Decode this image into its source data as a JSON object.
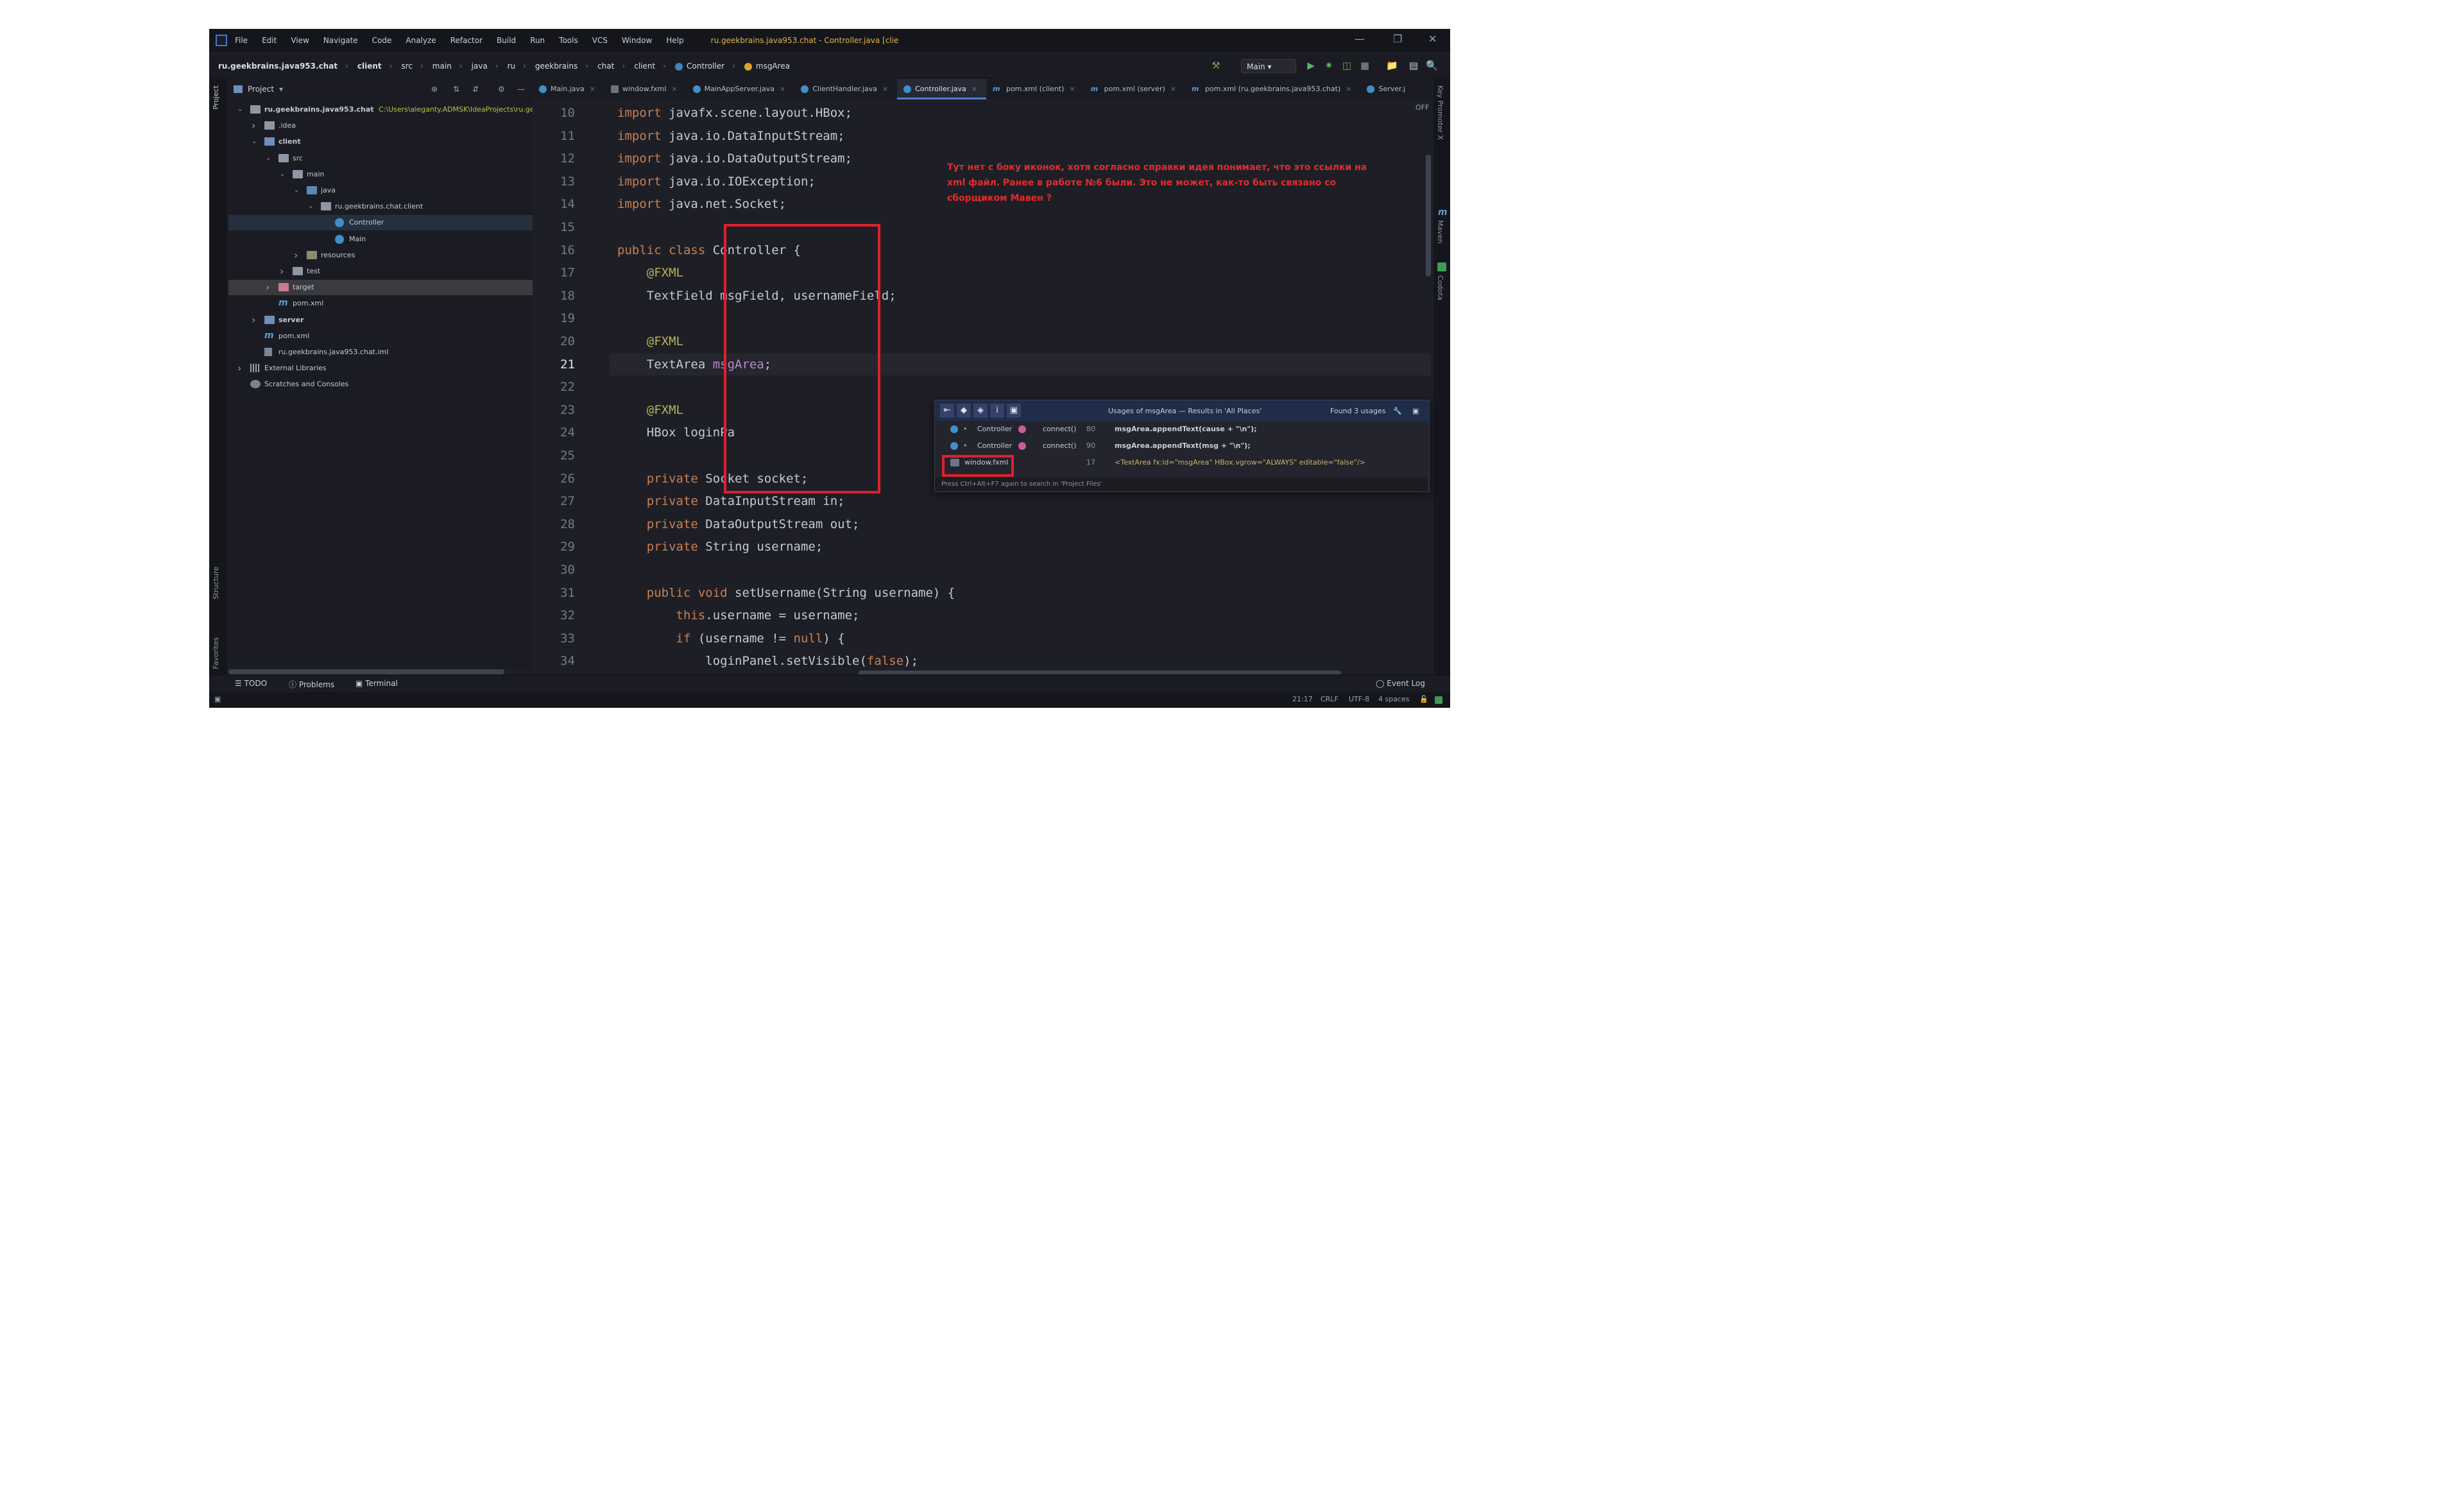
{
  "window": {
    "title": "ru.geekbrains.java953.chat - Controller.java [clie",
    "menu": [
      "File",
      "Edit",
      "View",
      "Navigate",
      "Code",
      "Analyze",
      "Refactor",
      "Build",
      "Run",
      "Tools",
      "VCS",
      "Window",
      "Help"
    ]
  },
  "breadcrumbs": [
    "ru.geekbrains.java953.chat",
    "client",
    "src",
    "main",
    "java",
    "ru",
    "geekbrains",
    "chat",
    "client",
    "Controller",
    "msgArea"
  ],
  "toolbar": {
    "run_config": "Main"
  },
  "left_strip": {
    "project": "Project",
    "structure": "Structure",
    "favorites": "Favorites"
  },
  "right_strip": {
    "key_promoter": "Key Promoter X",
    "maven": "Maven",
    "codota": "Codota"
  },
  "project_panel": {
    "title": "Project",
    "tree": [
      {
        "label": "ru.geekbrains.java953.chat",
        "extra": "C:\\Users\\aleganty.ADMSK\\IdeaProjects\\ru.gee",
        "depth": 0,
        "icon": "folder",
        "arrow": "down",
        "bold": true
      },
      {
        "label": ".idea",
        "depth": 1,
        "icon": "folder",
        "arrow": "right"
      },
      {
        "label": "client",
        "depth": 1,
        "icon": "folder-blue",
        "arrow": "down",
        "bold": true
      },
      {
        "label": "src",
        "depth": 2,
        "icon": "folder",
        "arrow": "down"
      },
      {
        "label": "main",
        "depth": 3,
        "icon": "folder",
        "arrow": "down"
      },
      {
        "label": "java",
        "depth": 4,
        "icon": "folder-src",
        "arrow": "down"
      },
      {
        "label": "ru.geekbrains.chat.client",
        "depth": 5,
        "icon": "folder",
        "arrow": "down"
      },
      {
        "label": "Controller",
        "depth": 6,
        "icon": "class",
        "selected": true
      },
      {
        "label": "Main",
        "depth": 6,
        "icon": "class"
      },
      {
        "label": "resources",
        "depth": 4,
        "icon": "folder-res",
        "arrow": "right"
      },
      {
        "label": "test",
        "depth": 3,
        "icon": "folder",
        "arrow": "right"
      },
      {
        "label": "target",
        "depth": 2,
        "icon": "folder-target",
        "arrow": "right",
        "highlight": true
      },
      {
        "label": "pom.xml",
        "depth": 2,
        "icon": "xml"
      },
      {
        "label": "server",
        "depth": 1,
        "icon": "folder-blue",
        "arrow": "right",
        "bold": true
      },
      {
        "label": "pom.xml",
        "depth": 1,
        "icon": "xml"
      },
      {
        "label": "ru.geekbrains.java953.chat.iml",
        "depth": 1,
        "icon": "iml"
      },
      {
        "label": "External Libraries",
        "depth": 0,
        "icon": "lib",
        "arrow": "right"
      },
      {
        "label": "Scratches and Consoles",
        "depth": 0,
        "icon": "scratch"
      }
    ]
  },
  "tabs": [
    {
      "label": "Main.java",
      "icon": "class"
    },
    {
      "label": "window.fxml",
      "icon": "fxml"
    },
    {
      "label": "MainAppServer.java",
      "icon": "class"
    },
    {
      "label": "ClientHandler.java",
      "icon": "class"
    },
    {
      "label": "Controller.java",
      "icon": "class",
      "active": true
    },
    {
      "label": "pom.xml (client)",
      "icon": "xml"
    },
    {
      "label": "pom.xml (server)",
      "icon": "xml"
    },
    {
      "label": "pom.xml (ru.geekbrains.java953.chat)",
      "icon": "xml"
    },
    {
      "label": "Server.j",
      "icon": "class"
    }
  ],
  "editor": {
    "current_line": 21,
    "lines": [
      {
        "n": 10,
        "html": "<span class=\"kw\">import</span> javafx.scene.layout.HBox;"
      },
      {
        "n": 11,
        "html": "<span class=\"kw\">import</span> java.io.DataInputStream;"
      },
      {
        "n": 12,
        "html": "<span class=\"kw\">import</span> java.io.DataOutputStream;"
      },
      {
        "n": 13,
        "html": "<span class=\"kw\">import</span> java.io.IOException;"
      },
      {
        "n": 14,
        "html": "<span class=\"kw\">import</span> java.net.Socket;"
      },
      {
        "n": 15,
        "html": ""
      },
      {
        "n": 16,
        "html": "<span class=\"kw\">public class</span> Controller {"
      },
      {
        "n": 17,
        "html": "    <span class=\"ann\">@FXML</span>"
      },
      {
        "n": 18,
        "html": "    TextField msgField, usernameField;"
      },
      {
        "n": 19,
        "html": ""
      },
      {
        "n": 20,
        "html": "    <span class=\"ann\">@FXML</span>"
      },
      {
        "n": 21,
        "html": "    TextArea <span class=\"fld\">msgArea</span>;"
      },
      {
        "n": 22,
        "html": ""
      },
      {
        "n": 23,
        "html": "    <span class=\"ann\">@FXML</span>"
      },
      {
        "n": 24,
        "html": "    HBox loginPa"
      },
      {
        "n": 25,
        "html": ""
      },
      {
        "n": 26,
        "html": "    <span class=\"kw\">private</span> Socket socket;"
      },
      {
        "n": 27,
        "html": "    <span class=\"kw\">private</span> DataInputStream in;"
      },
      {
        "n": 28,
        "html": "    <span class=\"kw\">private</span> DataOutputStream out;"
      },
      {
        "n": 29,
        "html": "    <span class=\"kw\">private</span> String username;"
      },
      {
        "n": 30,
        "html": ""
      },
      {
        "n": 31,
        "html": "    <span class=\"kw\">public void</span> setUsername(String username) {"
      },
      {
        "n": 32,
        "html": "        <span class=\"kw\">this</span>.username = username;"
      },
      {
        "n": 33,
        "html": "        <span class=\"kw\">if</span> (username != <span class=\"nul\">null</span>) {"
      },
      {
        "n": 34,
        "html": "            loginPanel.setVisible(<span class=\"kw\">false</span>);"
      }
    ],
    "off_label": "OFF"
  },
  "annotation": "Тут нет с боку иконок, хотя согласно справки идея понимает, что это ссылки на xml файл. Ранее в работе №6 были. Это не может, как-то быть связано со сборщиком Мавен ?",
  "popup": {
    "title": "Usages of msgArea — Results in 'All Places'",
    "found": "Found 3 usages",
    "rows": [
      {
        "cls": "Controller",
        "method": "connect()",
        "line": "80",
        "code": "msgArea.appendText(cause + \"\\n\");"
      },
      {
        "cls": "Controller",
        "method": "connect()",
        "line": "90",
        "code": "msgArea.appendText(msg + \"\\n\");"
      },
      {
        "cls": "window.fxml",
        "method": "",
        "line": "17",
        "code": "<TextArea fx:id=\"msgArea\" HBox.vgrow=\"ALWAYS\" editable=\"false\"/>"
      }
    ],
    "footer": "Press Ctrl+Alt+F7 again to search in 'Project Files'"
  },
  "bottom_tools": [
    "TODO",
    "Problems",
    "Terminal"
  ],
  "event_log": "Event Log",
  "status": {
    "position": "21:17",
    "line_sep": "CRLF",
    "encoding": "UTF-8",
    "indent": "4 spaces"
  },
  "colors": {
    "accent": "#4a7fd4",
    "annotation_red": "#e42b2b",
    "ide_bg": "#1e1f26"
  }
}
